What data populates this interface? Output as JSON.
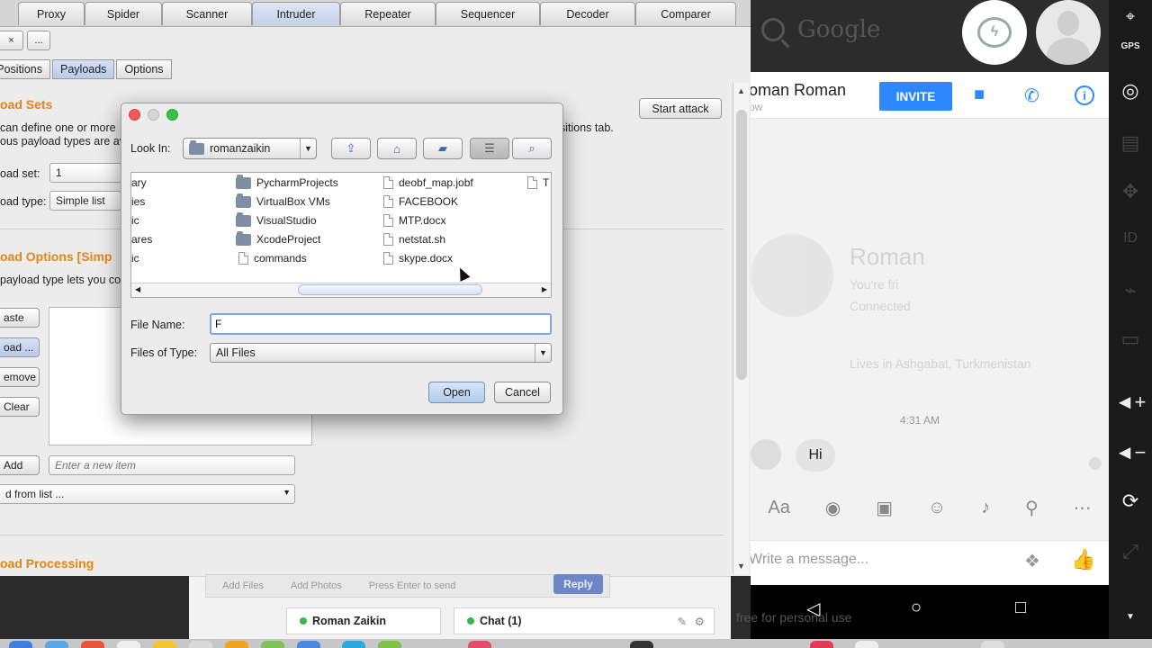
{
  "burp": {
    "main_tabs": [
      "Proxy",
      "Spider",
      "Scanner",
      "Intruder",
      "Repeater",
      "Sequencer",
      "Decoder",
      "Comparer"
    ],
    "active_main_tab": "Intruder",
    "tool_buttons": [
      "×",
      "..."
    ],
    "sub_tabs": [
      "Positions",
      "Payloads",
      "Options"
    ],
    "active_sub_tab": "Payloads",
    "payload_sets": {
      "title": "oad Sets",
      "desc1": "can define one or more",
      "desc1_tail": "sitions tab.",
      "desc2": "ous payload types are av",
      "set_label": "oad set:",
      "set_value": "1",
      "type_label": "oad type:",
      "type_value": "Simple list"
    },
    "start_attack": "Start attack",
    "payload_options": {
      "title": "oad Options [Simp",
      "desc": "payload type lets you co",
      "buttons": [
        "aste",
        "oad ...",
        "emove",
        "Clear"
      ],
      "add_button": "Add",
      "add_placeholder": "Enter a new item",
      "from_list": "d from list ..."
    },
    "payload_processing": {
      "title": "oad Processing"
    }
  },
  "dialog": {
    "look_in_label": "Look In:",
    "look_in_value": "romanzaikin",
    "columns": [
      {
        "items": [
          {
            "name": "ary"
          },
          {
            "name": "ies"
          },
          {
            "name": "ic"
          },
          {
            "name": "ares"
          },
          {
            "name": "ic"
          }
        ]
      },
      {
        "items": [
          {
            "name": "PycharmProjects",
            "kind": "folder"
          },
          {
            "name": "VirtualBox VMs",
            "kind": "folder"
          },
          {
            "name": "VisualStudio",
            "kind": "folder"
          },
          {
            "name": "XcodeProject",
            "kind": "folder"
          },
          {
            "name": "commands",
            "kind": "file"
          }
        ]
      },
      {
        "items": [
          {
            "name": "deobf_map.jobf",
            "kind": "file"
          },
          {
            "name": "FACEBOOK",
            "kind": "file"
          },
          {
            "name": "MTP.docx",
            "kind": "file"
          },
          {
            "name": "netstat.sh",
            "kind": "file"
          },
          {
            "name": "skype.docx",
            "kind": "file"
          }
        ]
      },
      {
        "items": [
          {
            "name": "T",
            "kind": "file"
          }
        ]
      }
    ],
    "file_name_label": "File Name:",
    "file_name_value": "F",
    "files_of_type_label": "Files of Type:",
    "files_of_type_value": "All Files",
    "open_button": "Open",
    "cancel_button": "Cancel"
  },
  "chat_popup": {
    "add_files": "Add Files",
    "add_photos": "Add Photos",
    "press_enter": "Press Enter to send",
    "reply": "Reply",
    "tab_contact": "Roman Zaikin",
    "tab_chat": "Chat (1)"
  },
  "emulator": {
    "search_text": "Google",
    "gps": "GPS",
    "messenger": {
      "contact_name": "oman Roman",
      "status": "ow",
      "invite": "INVITE",
      "profile_name": "Roman",
      "profile_sub": "You're fri",
      "profile_sub2": "Connected",
      "profile_location": "Lives in Ashgabat, Turkmenistan",
      "time": "4:31 AM",
      "message": "Hi",
      "compose_placeholder": "Write a message..."
    },
    "watermark": "free for personal use"
  },
  "colors": {
    "accent_orange": "#e0861a",
    "messenger_blue": "#2d88ff"
  }
}
